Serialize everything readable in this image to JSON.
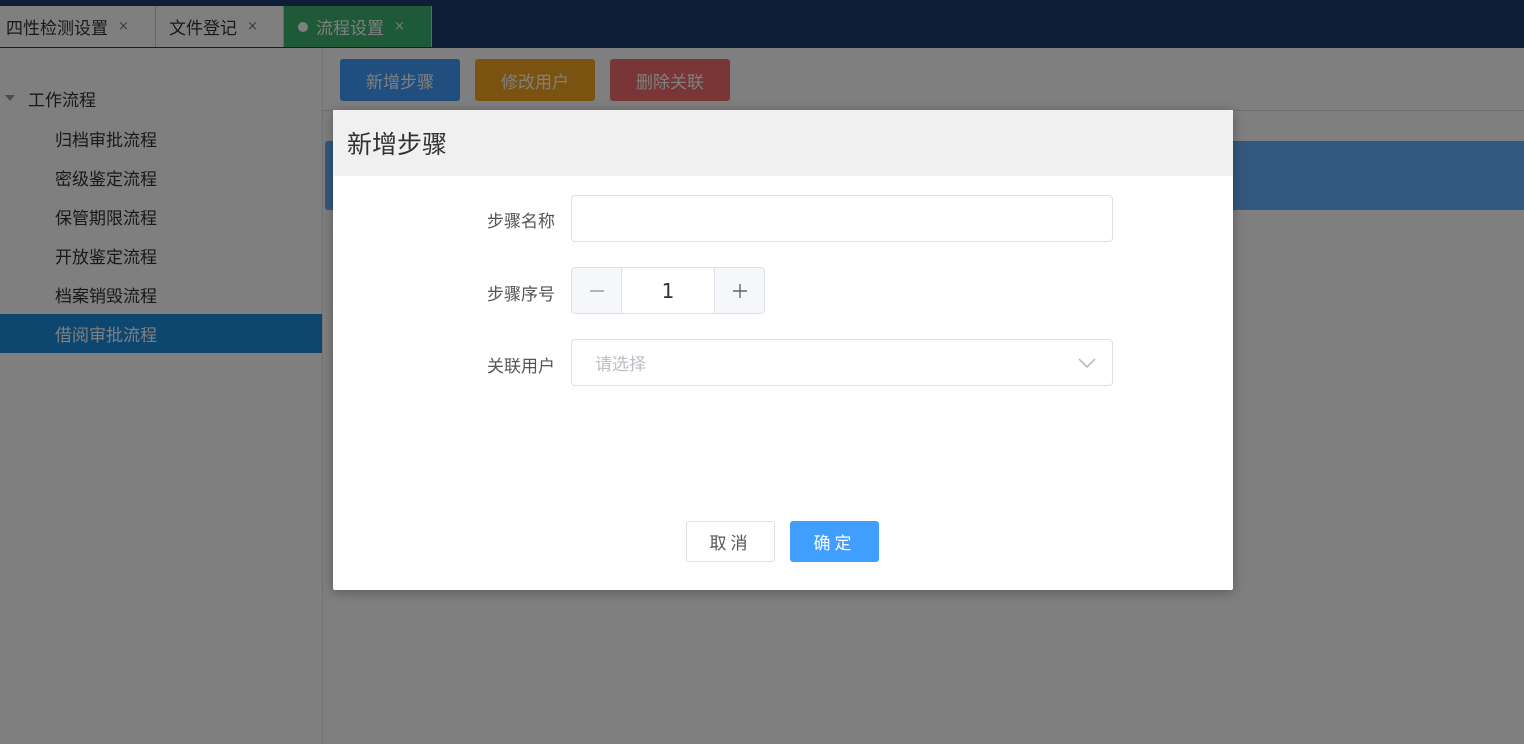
{
  "tabs": [
    {
      "label": "四性检测设置",
      "close": "×"
    },
    {
      "label": "文件登记",
      "close": "×"
    },
    {
      "label": "流程设置",
      "close": "×"
    }
  ],
  "sidebar": {
    "root_label": "工作流程",
    "items": [
      {
        "label": "归档审批流程"
      },
      {
        "label": "密级鉴定流程"
      },
      {
        "label": "保管期限流程"
      },
      {
        "label": "开放鉴定流程"
      },
      {
        "label": "档案销毁流程"
      },
      {
        "label": "借阅审批流程"
      }
    ],
    "selected_index": 5
  },
  "toolbar": {
    "add_label": "新增步骤",
    "edit_label": "修改用户",
    "delete_label": "删除关联"
  },
  "dialog": {
    "title": "新增步骤",
    "fields": {
      "step_name": {
        "label": "步骤名称",
        "value": ""
      },
      "step_order": {
        "label": "步骤序号",
        "value": "1"
      },
      "user": {
        "label": "关联用户",
        "placeholder": "请选择"
      }
    },
    "cancel_label": "取消",
    "ok_label": "确定"
  },
  "colors": {
    "tabbar": "#1e3a6e",
    "active_tab": "#3cb371",
    "primary": "#409eff",
    "warning": "#f5a623",
    "danger": "#f56c6c",
    "selected_item": "#1a8ee1"
  }
}
